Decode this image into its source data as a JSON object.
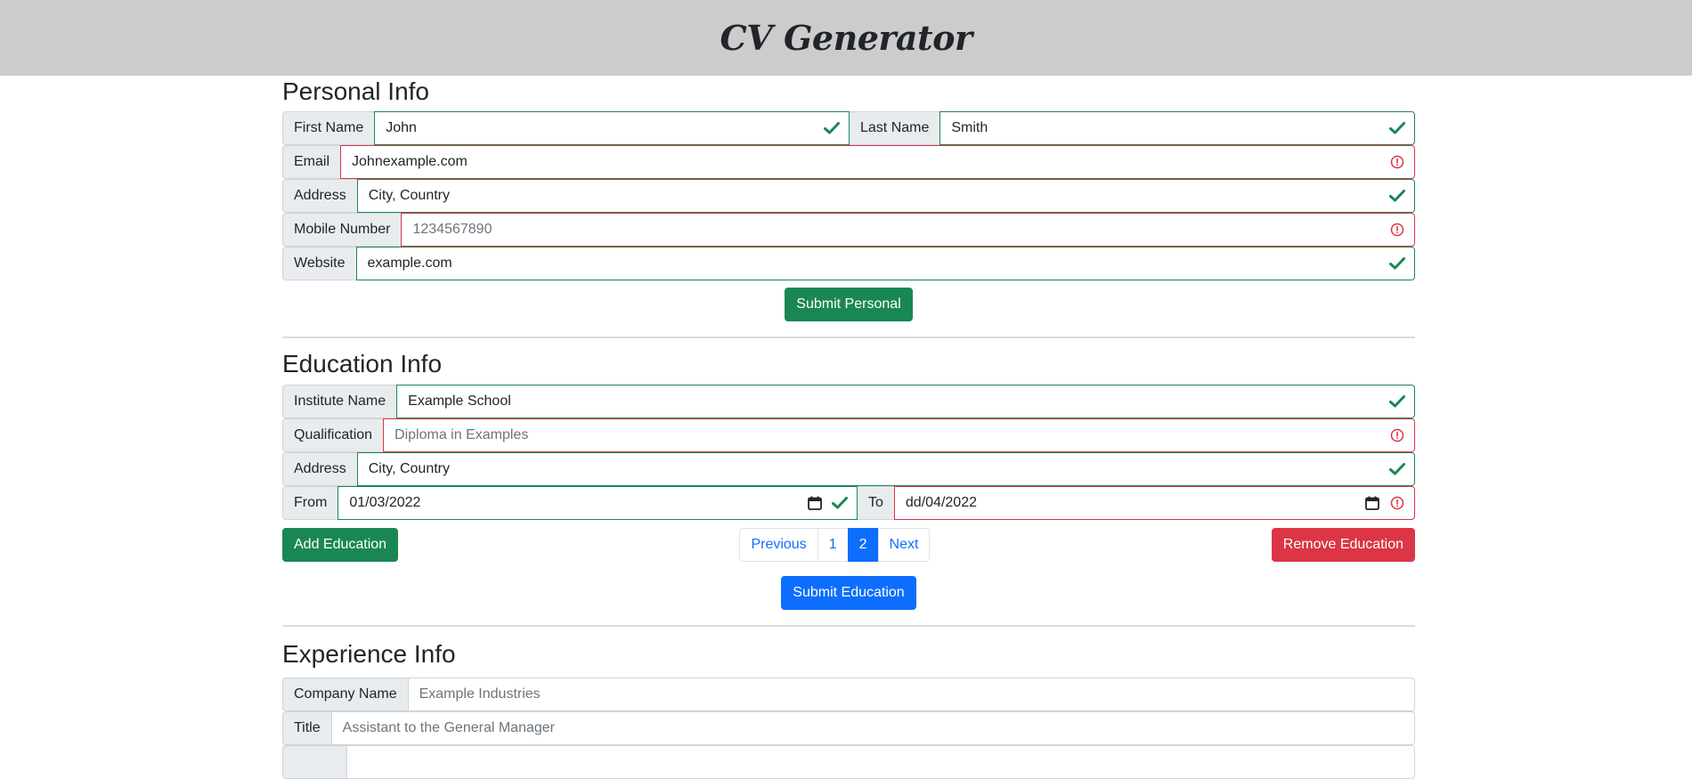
{
  "header": {
    "title": "CV Generator"
  },
  "personal": {
    "title": "Personal Info",
    "first_name": {
      "label": "First Name",
      "value": "John",
      "status": "valid"
    },
    "last_name": {
      "label": "Last Name",
      "value": "Smith",
      "status": "valid"
    },
    "email": {
      "label": "Email",
      "value": "Johnexample.com",
      "status": "invalid"
    },
    "address": {
      "label": "Address",
      "value": "City, Country",
      "status": "valid"
    },
    "mobile": {
      "label": "Mobile Number",
      "placeholder": "1234567890",
      "status": "invalid"
    },
    "website": {
      "label": "Website",
      "value": "example.com",
      "status": "valid"
    },
    "submit_label": "Submit Personal"
  },
  "education": {
    "title": "Education Info",
    "institute": {
      "label": "Institute Name",
      "value": "Example School",
      "status": "valid"
    },
    "qualification": {
      "label": "Qualification",
      "placeholder": "Diploma in Examples",
      "status": "invalid"
    },
    "address": {
      "label": "Address",
      "value": "City, Country",
      "status": "valid"
    },
    "from": {
      "label": "From",
      "value": "01/03/2022",
      "status": "valid"
    },
    "to": {
      "label": "To",
      "value": "dd/04/2022",
      "status": "invalid"
    },
    "add_label": "Add Education",
    "remove_label": "Remove Education",
    "pagination": {
      "previous": "Previous",
      "pages": [
        "1",
        "2"
      ],
      "active_page": "2",
      "next": "Next"
    },
    "submit_label": "Submit Education"
  },
  "experience": {
    "title": "Experience Info",
    "company": {
      "label": "Company Name",
      "placeholder": "Example Industries"
    },
    "job_title": {
      "label": "Title",
      "placeholder": "Assistant to the General Manager"
    }
  },
  "colors": {
    "valid": "#198754",
    "invalid": "#dc3545",
    "primary": "#0d6efd",
    "header_bg": "#cccccc"
  },
  "icons": {
    "valid": "check-icon",
    "invalid": "exclamation-circle-icon",
    "date": "calendar-icon"
  }
}
